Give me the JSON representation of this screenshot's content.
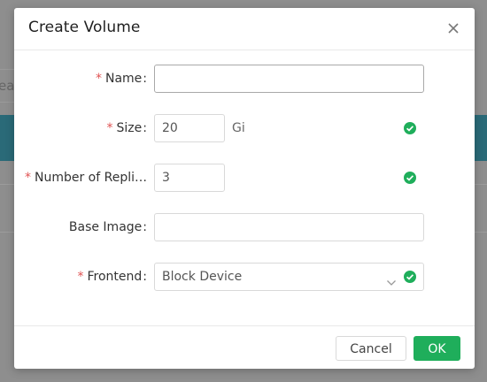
{
  "background": {
    "search_fragment": "ea"
  },
  "dialog": {
    "title": "Create Volume",
    "close_icon": "close-icon"
  },
  "form": {
    "name": {
      "label": "Name",
      "value": "",
      "required": true
    },
    "size": {
      "label": "Size",
      "value": "20",
      "unit": "Gi",
      "required": true,
      "valid": true
    },
    "replicas": {
      "label": "Number of Repli…",
      "value": "3",
      "required": true,
      "valid": true
    },
    "base_image": {
      "label": "Base Image",
      "value": "",
      "required": false
    },
    "frontend": {
      "label": "Frontend",
      "value": "Block Device",
      "required": true,
      "valid": true
    }
  },
  "footer": {
    "cancel_label": "Cancel",
    "ok_label": "OK"
  },
  "colors": {
    "accent": "#1fae5b",
    "required_star": "#e05252",
    "backdrop": "#8e8e8e",
    "band": "#2a6a78"
  }
}
